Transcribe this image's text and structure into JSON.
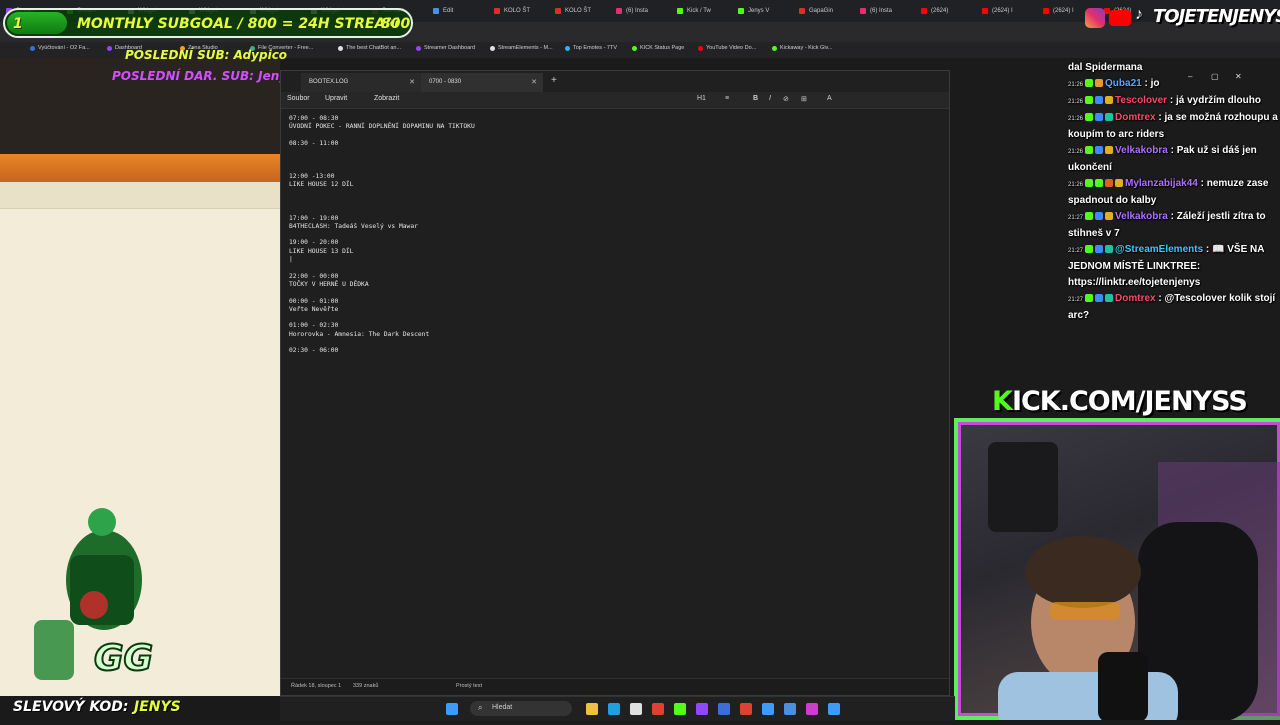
{
  "browser": {
    "tabs": [
      {
        "label": "Stream",
        "color": "#9147ff"
      },
      {
        "label": "Stream",
        "color": "#53fc18"
      },
      {
        "label": "Widget",
        "color": "#e0e0e0"
      },
      {
        "label": "Widget",
        "color": "#e0e0e0"
      },
      {
        "label": "Widget",
        "color": "#e0e0e0"
      },
      {
        "label": "Widget",
        "color": "#e0e0e0"
      },
      {
        "label": "Seznam",
        "color": "#cc3333"
      },
      {
        "label": "Edit",
        "color": "#4a90e2"
      },
      {
        "label": "KOLO ŠT",
        "color": "#d93025"
      },
      {
        "label": "KOLO ŠT",
        "color": "#d93025"
      },
      {
        "label": "(6) Insta",
        "color": "#e1306c"
      },
      {
        "label": "Kick / Tw",
        "color": "#53fc18"
      },
      {
        "label": "Jenys V",
        "color": "#53fc18"
      },
      {
        "label": "GapaGin",
        "color": "#d93025"
      },
      {
        "label": "(6) Insta",
        "color": "#e1306c"
      },
      {
        "label": "(2624)",
        "color": "#ff0000"
      },
      {
        "label": "(2624) I",
        "color": "#ff0000"
      },
      {
        "label": "(2624) I",
        "color": "#ff0000"
      },
      {
        "label": "(2624)",
        "color": "#ff0000"
      }
    ],
    "bookmarks": [
      {
        "label": "Vyúčtování - O2 Fa...",
        "color": "#3b6fd6"
      },
      {
        "label": "Dashboard",
        "color": "#9147ff"
      },
      {
        "label": "Zona Studio",
        "color": "#f0a020"
      },
      {
        "label": "File Converter - Free...",
        "color": "#3bb273"
      },
      {
        "label": "The best ChatBot an...",
        "color": "#e0e0e0"
      },
      {
        "label": "Streamer Dashboard",
        "color": "#9147ff"
      },
      {
        "label": "StreamElements - M...",
        "color": "#e0e0e0"
      },
      {
        "label": "Top Emotes - 7TV",
        "color": "#29b6f6"
      },
      {
        "label": "KICK Status Page",
        "color": "#53fc18"
      },
      {
        "label": "YouTube Video Do...",
        "color": "#ff0000"
      },
      {
        "label": "Kickaway - Kick Giv...",
        "color": "#53fc18"
      }
    ]
  },
  "overlay": {
    "goal_left": "1",
    "goal_text": "MONTHLY SUBGOAL / 800 = 24H STREAM",
    "goal_right": "800",
    "goal_progress": 0.02,
    "last_sub_label": "POSLEDNÍ SUB:",
    "last_sub_name": "Adypico",
    "last_gift_label": "POSLEDNÍ DAR. SUB:",
    "last_gift_name": "Jenyss",
    "brand": "TOJETENJENYS",
    "kick_url": "KICK.COM/JENYSS",
    "promo_label": "SLEVOVÝ KOD:",
    "promo_code": "JENYS",
    "accent": "#53fc18"
  },
  "notepad": {
    "tabs": [
      {
        "label": "BOOTEX.LOG"
      },
      {
        "label": "0700 - 0830"
      }
    ],
    "menu": {
      "file": "Soubor",
      "edit": "Upravit",
      "view": "Zobrazit"
    },
    "format": {
      "heading": "H1",
      "list": "≡",
      "bold": "B",
      "italic": "I",
      "link": "⊘",
      "table": "⊞",
      "clear": "A"
    },
    "content": "07:00 - 08:30\nÚVODNÍ POKEC - RANNÍ DOPLNĚNÍ DOPAMINU NA TIKTOKU\n\n08:30 - 11:00\n\n\n\n12:00 -13:00\nLIKE HOUSE 12 DÍL\n\n\n\n17:00 - 19:00\nB4THECLASH: Tadeáš Veselý vs Mawar\n\n19:00 - 20:00\nLIKE HOUSE 13 DÍL\n|\n\n22:00 - 00:00\nTOČKY V HERNĚ U DĚDKA\n\n00:00 - 01:00\nVeřte Nevěřte\n\n01:00 - 02:30\nHororovka - Amnesia: The Dark Descent\n\n02:30 - 06:00",
    "status": {
      "position": "Řádek 18, sloupec 1",
      "chars": "339 znaků",
      "mode": "Prostý text"
    }
  },
  "chat": [
    {
      "time": "",
      "badges": [],
      "user": "",
      "user_color": "#ffffff",
      "text": "dal Spidermana"
    },
    {
      "time": "21:26",
      "badges": [
        "#53fc18",
        "#e89b2a"
      ],
      "user": "Quba21",
      "user_color": "#5aa8ff",
      "text": "jo"
    },
    {
      "time": "21:26",
      "badges": [
        "#53fc18",
        "#3b8bff",
        "#e0b020"
      ],
      "user": "Tescolover",
      "user_color": "#ff4a6a",
      "text": "já vydržím dlouho"
    },
    {
      "time": "21:26",
      "badges": [
        "#53fc18",
        "#3b8bff",
        "#20c0a0"
      ],
      "user": "Domtrex",
      "user_color": "#ff4a6a",
      "text": "ja se možná rozhoupu a koupím to arc riders"
    },
    {
      "time": "21:26",
      "badges": [
        "#53fc18",
        "#3b8bff",
        "#e0b020"
      ],
      "user": "Velkakobra",
      "user_color": "#b070ff",
      "text": "Pak už si dáš jen ukončení"
    },
    {
      "time": "21:26",
      "badges": [
        "#53fc18",
        "#53fc18",
        "#e06020",
        "#e0b020"
      ],
      "user": "Mylanzabijak44",
      "user_color": "#b070ff",
      "text": "nemuze zase spadnout do kalby"
    },
    {
      "time": "21:27",
      "badges": [
        "#53fc18",
        "#3b8bff",
        "#e0b020"
      ],
      "user": "Velkakobra",
      "user_color": "#b070ff",
      "text": "Záleží jestli zítra to stihneš v 7"
    },
    {
      "time": "21:27",
      "badges": [
        "#53fc18",
        "#3b8bff",
        "#20c0a0"
      ],
      "user": "@StreamElements",
      "user_color": "#40c8ff",
      "text": "📖 VŠE NA JEDNOM MÍSTĚ LINKTREE: https://linktr.ee/tojetenjenys"
    },
    {
      "time": "21:27",
      "badges": [
        "#53fc18",
        "#3b8bff",
        "#20c0a0"
      ],
      "user": "Domtrex",
      "user_color": "#ff4a6a",
      "text": "@Tescolover kolik stojí arc?"
    }
  ],
  "taskbar": {
    "search_placeholder": "Hledat",
    "icons": [
      {
        "name": "windows-icon",
        "color": "#3b9bff"
      },
      {
        "name": "file-explorer-icon",
        "color": "#f0c040"
      },
      {
        "name": "edge-icon",
        "color": "#1fa0e0"
      },
      {
        "name": "store-icon",
        "color": "#e0e0e0"
      },
      {
        "name": "chrome-icon",
        "color": "#e04030"
      },
      {
        "name": "app-icon",
        "color": "#53fc18"
      },
      {
        "name": "app-icon",
        "color": "#9147ff"
      },
      {
        "name": "app-icon",
        "color": "#3b6fd6"
      },
      {
        "name": "app-icon",
        "color": "#e04030"
      },
      {
        "name": "app-icon",
        "color": "#3b9bff"
      },
      {
        "name": "app-icon",
        "color": "#4a90e2"
      },
      {
        "name": "app-icon",
        "color": "#d03cd0"
      },
      {
        "name": "notepad-icon",
        "color": "#3b9bff"
      }
    ]
  }
}
